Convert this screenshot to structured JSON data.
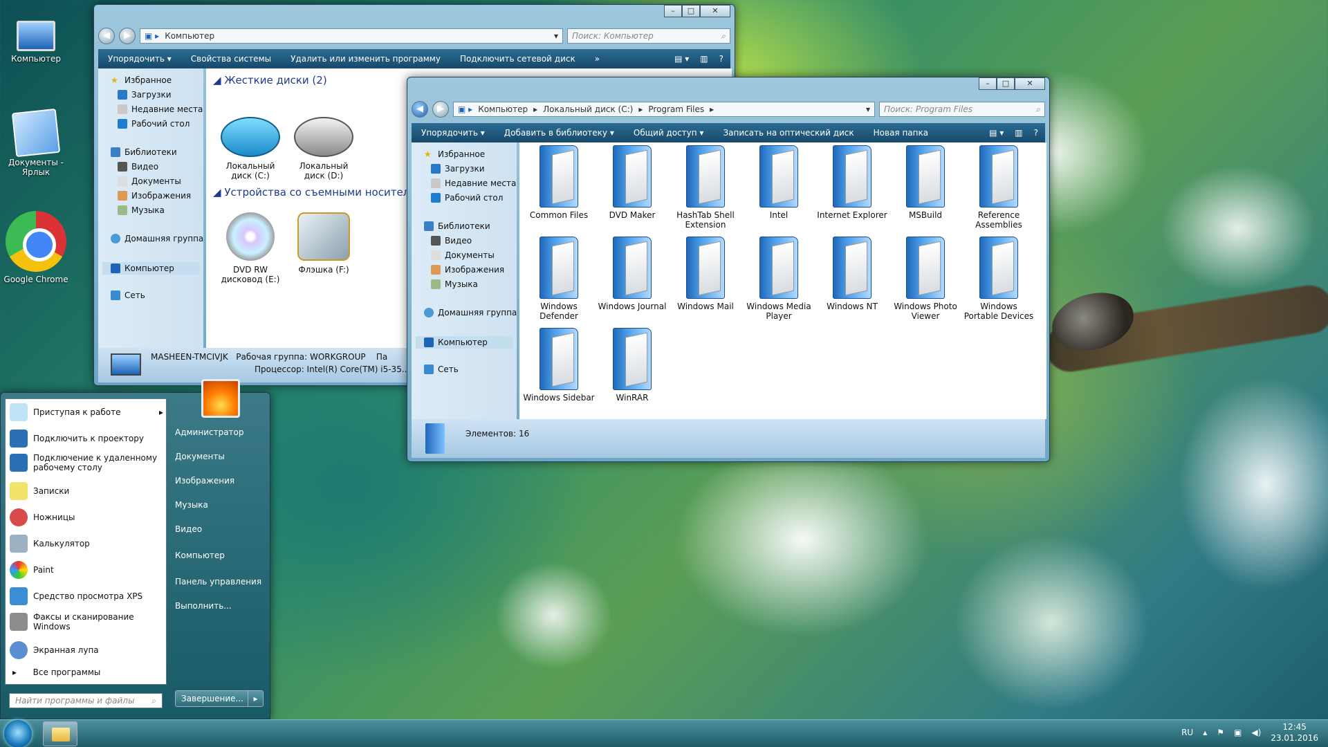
{
  "desktop": {
    "icons": [
      {
        "label": "Компьютер",
        "icon": "computer-icon"
      },
      {
        "label": "Документы - Ярлык",
        "icon": "documents-shortcut-icon"
      },
      {
        "label": "Google Chrome",
        "icon": "chrome-icon"
      }
    ]
  },
  "win_computer": {
    "address": "Компьютер",
    "search_placeholder": "Поиск: Компьютер",
    "toolbar": [
      "Упорядочить",
      "Свойства системы",
      "Удалить или изменить программу",
      "Подключить сетевой диск",
      "»"
    ],
    "nav": {
      "favorites": "Избранное",
      "downloads": "Загрузки",
      "recent": "Недавние места",
      "desktop": "Рабочий стол",
      "libraries": "Библиотеки",
      "video": "Видео",
      "documents": "Документы",
      "images": "Изображения",
      "music": "Музыка",
      "homegroup": "Домашняя группа",
      "computer": "Компьютер",
      "network": "Сеть"
    },
    "group_hdd": "Жесткие диски (2)",
    "group_removable": "Устройства со съемными носителями",
    "drives": [
      {
        "label": "Локальный диск (C:)"
      },
      {
        "label": "Локальный диск (D:)"
      }
    ],
    "removable": [
      {
        "label": "DVD RW дисковод (E:)"
      },
      {
        "label": "Флэшка (F:)"
      }
    ],
    "details": {
      "name": "MASHEEN-TMCIVJK",
      "workgroup": "Рабочая группа: WORKGROUP",
      "cpu": "Процессор: Intel(R) Core(TM) i5-35...",
      "extra": "Па"
    }
  },
  "win_program_files": {
    "breadcrumb": [
      "Компьютер",
      "Локальный диск (C:)",
      "Program Files"
    ],
    "search_placeholder": "Поиск: Program Files",
    "toolbar": [
      "Упорядочить",
      "Добавить в библиотеку",
      "Общий доступ",
      "Записать на оптический диск",
      "Новая папка"
    ],
    "folders": [
      "Common Files",
      "DVD Maker",
      "HashTab Shell Extension",
      "Intel",
      "Internet Explorer",
      "MSBuild",
      "Reference Assemblies",
      "Windows Defender",
      "Windows Journal",
      "Windows Mail",
      "Windows Media Player",
      "Windows NT",
      "Windows Photo Viewer",
      "Windows Portable Devices",
      "Windows Sidebar",
      "WinRAR"
    ],
    "status": "Элементов: 16"
  },
  "start_menu": {
    "programs": [
      "Приступая к работе",
      "Подключить к проектору",
      "Подключение к удаленному рабочему столу",
      "Записки",
      "Ножницы",
      "Калькулятор",
      "Paint",
      "Средство просмотра XPS",
      "Факсы и сканирование Windows",
      "Экранная лупа"
    ],
    "all_programs": "Все программы",
    "search_placeholder": "Найти программы и файлы",
    "right": [
      "Администратор",
      "Документы",
      "Изображения",
      "Музыка",
      "Видео",
      "Компьютер",
      "Панель управления",
      "Выполнить..."
    ],
    "shutdown": "Завершение..."
  },
  "taskbar": {
    "lang": "RU",
    "time": "12:45",
    "date": "23.01.2016"
  }
}
